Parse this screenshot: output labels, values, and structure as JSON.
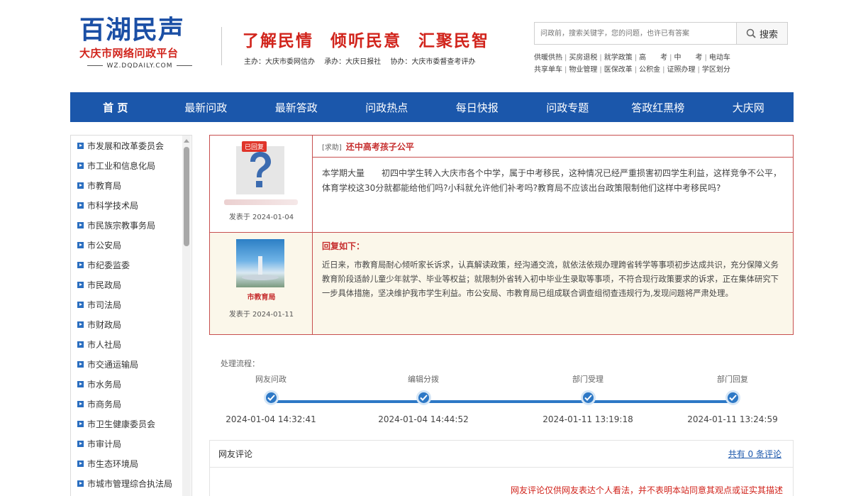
{
  "logo": {
    "main": "百湖民声",
    "sub": "大庆市网络问政平台",
    "url": "WZ.DQDAILY.COM"
  },
  "slogan": [
    "了解民情",
    "倾听民意",
    "汇聚民智"
  ],
  "sponsors": [
    "主办：大庆市委网信办",
    "承办：大庆日报社",
    "协办：大庆市委督查考评办"
  ],
  "search": {
    "placeholder": "问政前，搜索关键字，您的问题，也许已有答案",
    "button": "搜索"
  },
  "hot_tags": [
    [
      "供暖供热",
      "买房退税",
      "就学政策",
      "高　　考",
      "中　　考",
      "电动车"
    ],
    [
      "共享单车",
      "物业管理",
      "医保改革",
      "公积金",
      "证照办理",
      "学区划分"
    ]
  ],
  "nav": [
    "首 页",
    "最新问政",
    "最新答政",
    "问政热点",
    "每日快报",
    "问政专题",
    "答政红黑榜",
    "大庆网"
  ],
  "sidebar": {
    "items": [
      "市发展和改革委员会",
      "市工业和信息化局",
      "市教育局",
      "市科学技术局",
      "市民族宗教事务局",
      "市公安局",
      "市纪委监委",
      "市民政局",
      "市司法局",
      "市财政局",
      "市人社局",
      "市交通运输局",
      "市水务局",
      "市商务局",
      "市卫生健康委员会",
      "市审计局",
      "市生态环境局",
      "市城市管理综合执法局"
    ]
  },
  "question": {
    "badge": "已回复",
    "date": "发表于 2024-01-04",
    "tag": "[求助]",
    "title": "还中高考孩子公平",
    "body": "本学期大量　　初四中学生转入大庆市各个中学，属于中考移民，这种情况已经严重损害初四学生利益，这样竞争不公平，体育学校这30分就都能给他们吗?小科就允许他们补考吗?教育局不应该出台政策限制他们这样中考移民吗?"
  },
  "reply": {
    "dept": "市教育局",
    "date": "发表于 2024-01-11",
    "title": "回复如下：",
    "body": "近日来，市教育局耐心倾听家长诉求，认真解读政策，经沟通交流，就依法依规办理跨省转学等事项初步达成共识，充分保障义务教育阶段适龄儿童少年就学、毕业等权益；就限制外省转入初中毕业生录取等事项，不符合现行政策要求的诉求，正在集体研究下一步具体措施，坚决维护我市学生利益。市公安局、市教育局已组成联合调查组彻查违规行为,发现问题将严肃处理。"
  },
  "process": {
    "label": "处理流程：",
    "steps": [
      {
        "name": "网友问政",
        "time": "2024-01-04 14:32:41"
      },
      {
        "name": "编辑分拨",
        "time": "2024-01-04 14:44:52"
      },
      {
        "name": "部门受理",
        "time": "2024-01-11 13:19:18"
      },
      {
        "name": "部门回复",
        "time": "2024-01-11 13:24:59"
      }
    ]
  },
  "comments": {
    "title": "网友评论",
    "count": "共有 0 条评论",
    "disclaimer": "网友评论仅供网友表达个人看法，并不表明本站同意其观点或证实其描述"
  },
  "colors": {
    "brand_blue": "#1b57ab",
    "brand_red": "#d1241c",
    "progress_blue": "#2d78c6"
  }
}
